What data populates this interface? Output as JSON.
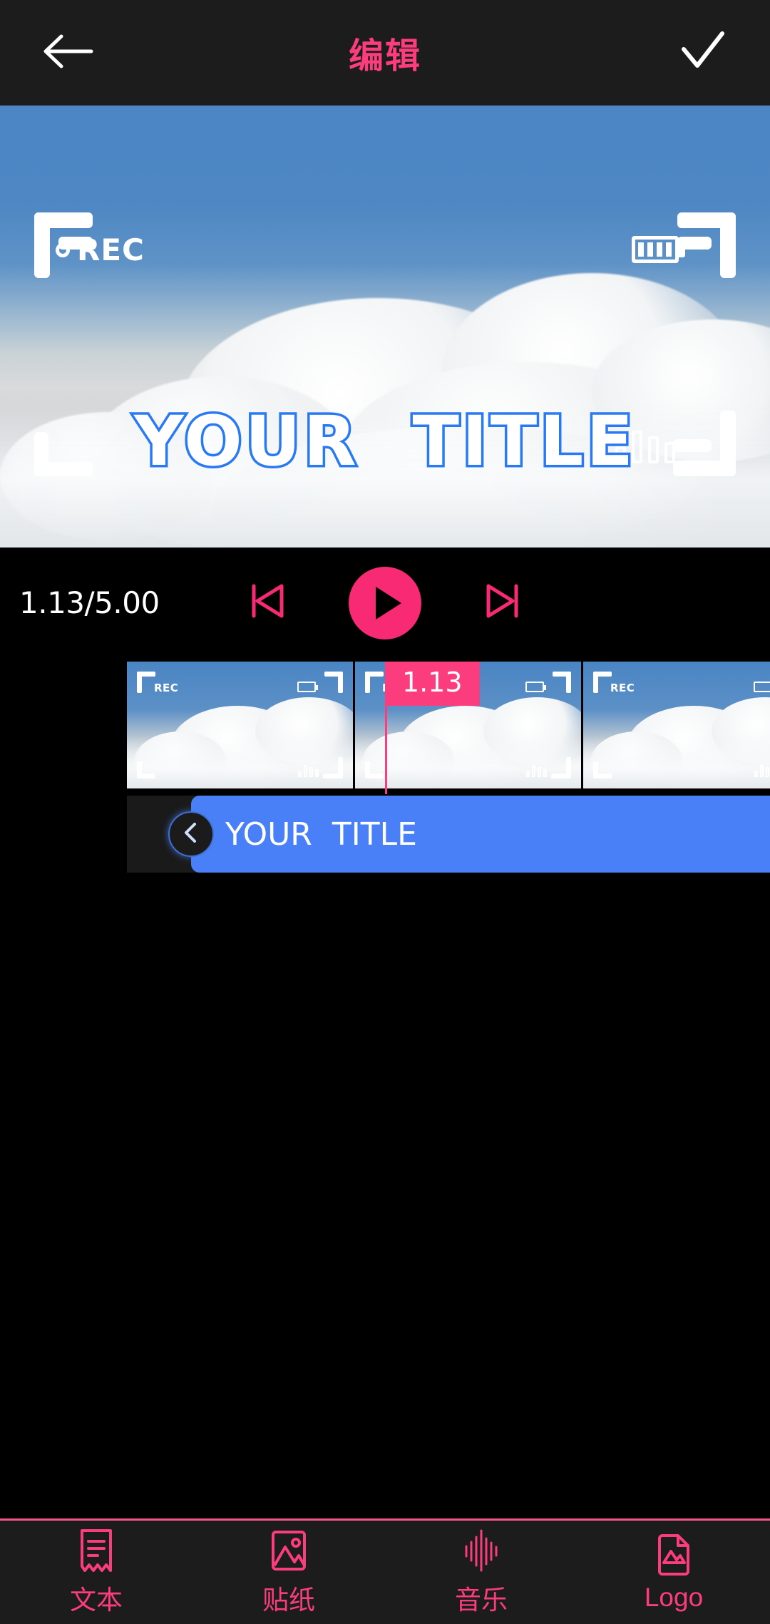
{
  "header": {
    "back_icon": "arrow-left-icon",
    "title": "编辑",
    "confirm_icon": "check-icon"
  },
  "preview": {
    "overlay": {
      "rec_text": "REC",
      "rec_dot": "record-dot-icon",
      "battery_icon": "battery-icon",
      "signal_icon": "signal-bars-icon",
      "corner_brackets": "corner-frame-icon"
    },
    "title_text": "YOUR  TITLE",
    "title_fill": "#ffffff",
    "title_stroke": "#2979f5"
  },
  "playback": {
    "time_readout": "1.13/5.00",
    "current_time": "1.13",
    "total_time": "5.00",
    "prev_icon": "skip-previous-icon",
    "play_icon": "play-icon",
    "next_icon": "skip-next-icon",
    "accent_color": "#f72a73"
  },
  "timeline": {
    "playhead_time": "1.13",
    "playhead_color": "#fb3d7e",
    "thumbnails": [
      {
        "rec_text": "REC"
      },
      {
        "rec_text": "REC"
      },
      {
        "rec_text": "REC"
      }
    ],
    "text_track": {
      "clip_label": "YOUR  TITLE",
      "clip_color": "#4a80f7",
      "handle_icon": "chevron-left-icon"
    }
  },
  "bottom_nav": {
    "accent_color": "#fb3d7e",
    "items": [
      {
        "label": "文本",
        "icon": "text-document-icon"
      },
      {
        "label": "贴纸",
        "icon": "sticker-image-icon"
      },
      {
        "label": "音乐",
        "icon": "music-waveform-icon"
      },
      {
        "label": "Logo",
        "icon": "logo-file-image-icon"
      }
    ]
  }
}
